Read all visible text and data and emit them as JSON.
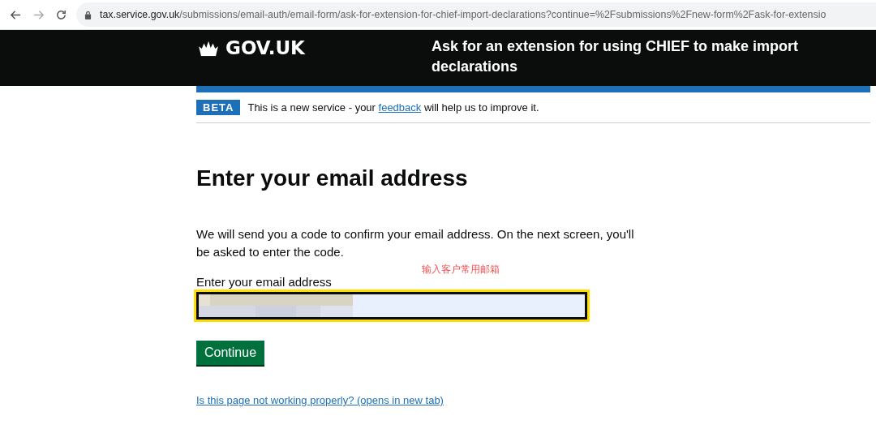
{
  "browser": {
    "host": "tax.service.gov.uk",
    "path": "/submissions/email-auth/email-form/ask-for-extension-for-chief-import-declarations?continue=%2Fsubmissions%2Fnew-form%2Fask-for-extensio"
  },
  "header": {
    "logo": "GOV.UK",
    "service_name": "Ask for an extension for using CHIEF to make import declarations"
  },
  "phase_banner": {
    "tag": "BETA",
    "text_before": "This is a new service - your",
    "link": "feedback",
    "text_after": "will help us to improve it."
  },
  "heading": "Enter your email address",
  "intro": "We will send you a code to confirm your email address. On the next screen, you'll be asked to enter the code.",
  "annotation": "输入客户常用邮箱",
  "email_field": {
    "label": "Enter your email address",
    "focused": true
  },
  "continue_button": "Continue",
  "help_link": "Is this page not working properly? (opens in new tab)"
}
